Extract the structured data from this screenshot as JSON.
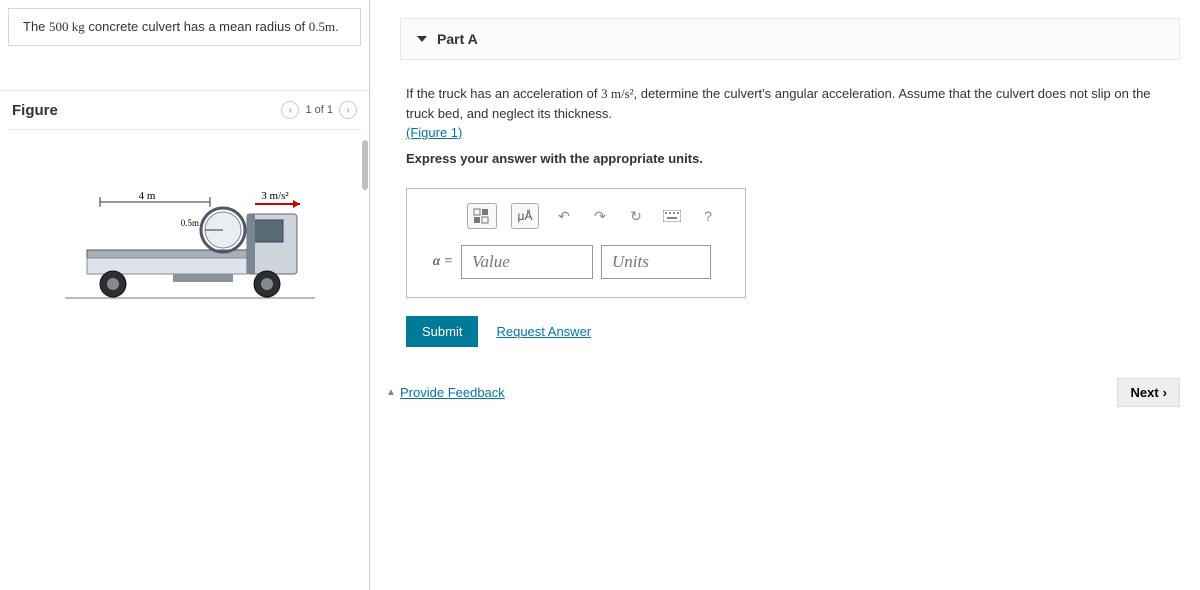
{
  "problem": {
    "prefix": "The ",
    "mass": "500 kg",
    "mid": " concrete culvert has a mean radius of ",
    "radius": "0.5m",
    "suffix": "."
  },
  "figure": {
    "title": "Figure",
    "pager": "1 of 1"
  },
  "diagram": {
    "length_label": "4 m",
    "radius_label": "0.5m",
    "accel_label": "3 m/s²"
  },
  "part": {
    "header": "Part A",
    "line1_a": "If the truck has an acceleration of ",
    "line1_accel": "3 m/s²",
    "line1_b": ", determine the culvert's angular acceleration. Assume that the culvert does not slip on the truck bed, and neglect its thickness.",
    "figure_link": "(Figure 1)",
    "express": "Express your answer with the appropriate units."
  },
  "toolbar": {
    "units_btn": "μÅ",
    "help": "?"
  },
  "answer": {
    "label": "α =",
    "value_placeholder": "Value",
    "units_placeholder": "Units"
  },
  "actions": {
    "submit": "Submit",
    "request": "Request Answer",
    "feedback": "Provide Feedback",
    "next": "Next"
  }
}
